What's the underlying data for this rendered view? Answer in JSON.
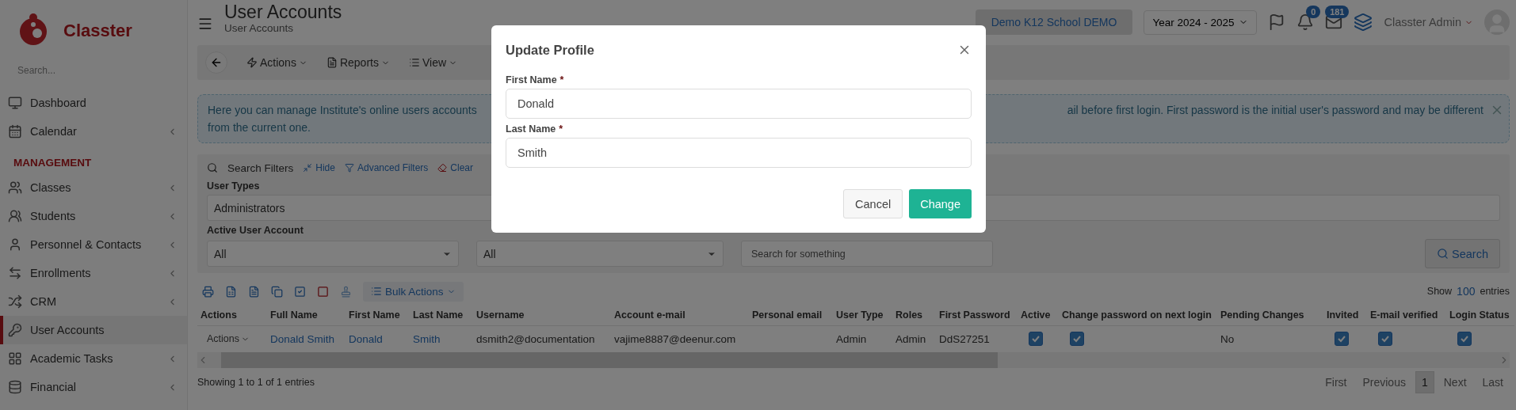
{
  "sidebar": {
    "brand": "Classter",
    "search_placeholder": "Search...",
    "items": [
      {
        "label": "Dashboard",
        "selected": false,
        "expandable": false
      },
      {
        "label": "Calendar",
        "selected": false,
        "expandable": true
      }
    ],
    "sections": [
      {
        "title": "MANAGEMENT",
        "items": [
          {
            "label": "Classes",
            "selected": false,
            "expandable": true
          },
          {
            "label": "Students",
            "selected": false,
            "expandable": true
          },
          {
            "label": "Personnel & Contacts",
            "selected": false,
            "expandable": true
          },
          {
            "label": "Enrollments",
            "selected": false,
            "expandable": true
          },
          {
            "label": "CRM",
            "selected": false,
            "expandable": true
          },
          {
            "label": "User Accounts",
            "selected": true,
            "expandable": false
          },
          {
            "label": "Academic Tasks",
            "selected": false,
            "expandable": true
          },
          {
            "label": "Financial",
            "selected": false,
            "expandable": true
          }
        ]
      }
    ]
  },
  "header": {
    "title": "User Accounts",
    "subtitle": "User Accounts",
    "school": "Demo K12 School DEMO",
    "year": "Year 2024 - 2025",
    "notifications": "0",
    "messages": "181",
    "user": "Classter Admin"
  },
  "toolbar": [
    "Actions",
    "Reports",
    "View"
  ],
  "info": {
    "left": "Here you can manage Institute's online users accounts",
    "right": "ail before first login. First password is the initial user's password and may be different",
    "line2": "from the current one."
  },
  "filters": {
    "title": "Search Filters",
    "links": [
      "Hide",
      "Advanced Filters",
      "Clear"
    ],
    "user_types_label": "User Types",
    "user_types_value": "Administrators",
    "active_label": "Active User Account",
    "selects": [
      "All",
      "All"
    ],
    "search_placeholder": "Search for something",
    "search_button": "Search"
  },
  "table": {
    "bulk_actions": "Bulk Actions",
    "show": "Show",
    "page_size": "100",
    "entries": "entries",
    "columns": [
      "Actions",
      "Full Name",
      "First Name",
      "Last Name",
      "Username",
      "Account e-mail",
      "Personal email",
      "User Type",
      "Roles",
      "First Password",
      "Active",
      "Change password on next login",
      "Pending Changes",
      "Invited",
      "E-mail verified",
      "Login Status"
    ],
    "rows": [
      {
        "cells": [
          {
            "kind": "menu",
            "text": "Actions"
          },
          {
            "kind": "link",
            "text": "Donald Smith"
          },
          {
            "kind": "link",
            "text": "Donald"
          },
          {
            "kind": "link",
            "text": "Smith"
          },
          {
            "kind": "text",
            "text": "dsmith2@documentation"
          },
          {
            "kind": "text",
            "text": "vajime8887@deenur.com"
          },
          {
            "kind": "empty"
          },
          {
            "kind": "text",
            "text": "Admin"
          },
          {
            "kind": "text",
            "text": "Admin"
          },
          {
            "kind": "text",
            "text": "DdS27251"
          },
          {
            "kind": "check",
            "checked": true
          },
          {
            "kind": "check",
            "checked": true
          },
          {
            "kind": "text",
            "text": "No"
          },
          {
            "kind": "check",
            "checked": true
          },
          {
            "kind": "check",
            "checked": true
          },
          {
            "kind": "check",
            "checked": true
          }
        ]
      }
    ],
    "summary": "Showing 1 to 1 of 1 entries",
    "pages": [
      {
        "label": "First",
        "selected": false
      },
      {
        "label": "Previous",
        "selected": false
      },
      {
        "label": "1",
        "selected": true
      },
      {
        "label": "Next",
        "selected": false
      },
      {
        "label": "Last",
        "selected": false
      }
    ]
  },
  "modal": {
    "title": "Update Profile",
    "fields": [
      {
        "label": "First Name",
        "required_mark": "*",
        "value": "Donald"
      },
      {
        "label": "Last Name",
        "required_mark": "*",
        "value": "Smith"
      }
    ],
    "cancel": "Cancel",
    "confirm": "Change"
  }
}
